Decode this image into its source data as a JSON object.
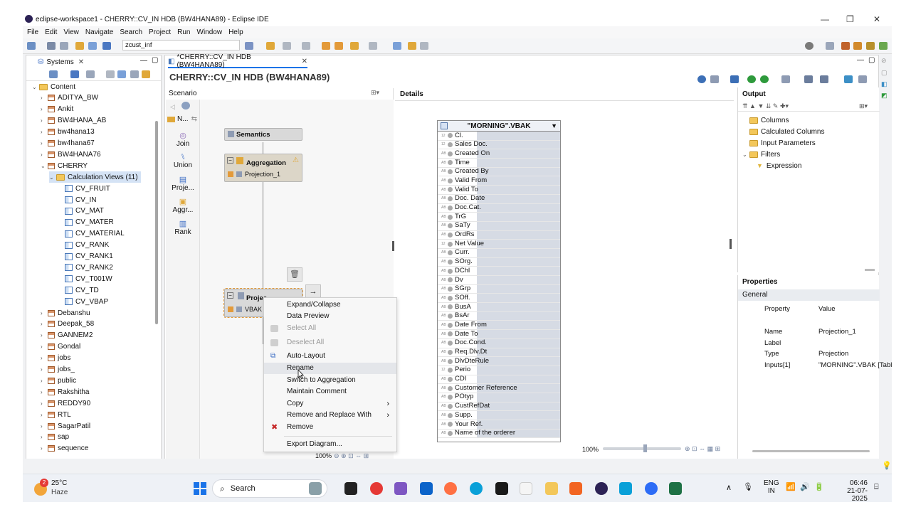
{
  "window": {
    "title": "eclipse-workspace1 - CHERRY::CV_IN HDB (BW4HANA89) - Eclipse IDE",
    "minimize": "—",
    "restore": "❐",
    "close": "✕"
  },
  "menu": [
    "File",
    "Edit",
    "View",
    "Navigate",
    "Search",
    "Project",
    "Run",
    "Window",
    "Help"
  ],
  "toolbar": {
    "search_value": "zcust_inf"
  },
  "systems": {
    "tab_label": "Systems",
    "items": [
      {
        "label": "Content",
        "type": "folder",
        "expanded": true
      },
      {
        "label": "ADITYA_BW",
        "type": "package"
      },
      {
        "label": "Ankit",
        "type": "package"
      },
      {
        "label": "BW4HANA_AB",
        "type": "package"
      },
      {
        "label": "bw4hana13",
        "type": "package"
      },
      {
        "label": "bw4hana67",
        "type": "package"
      },
      {
        "label": "BW4HANA76",
        "type": "package"
      },
      {
        "label": "CHERRY",
        "type": "package",
        "expanded": true
      },
      {
        "label": "Calculation Views (11)",
        "type": "folder",
        "expanded": true,
        "selected": true
      },
      {
        "label": "CV_FRUIT",
        "type": "cv"
      },
      {
        "label": "CV_IN",
        "type": "cv"
      },
      {
        "label": "CV_MAT",
        "type": "cv"
      },
      {
        "label": "CV_MATER",
        "type": "cv"
      },
      {
        "label": "CV_MATERIAL",
        "type": "cv"
      },
      {
        "label": "CV_RANK",
        "type": "cv"
      },
      {
        "label": "CV_RANK1",
        "type": "cv"
      },
      {
        "label": "CV_RANK2",
        "type": "cv"
      },
      {
        "label": "CV_T001W",
        "type": "cv"
      },
      {
        "label": "CV_TD",
        "type": "cv"
      },
      {
        "label": "CV_VBAP",
        "type": "cv"
      },
      {
        "label": "Debanshu",
        "type": "package"
      },
      {
        "label": "Deepak_58",
        "type": "package"
      },
      {
        "label": "GANNEM2",
        "type": "package"
      },
      {
        "label": "Gondal",
        "type": "package"
      },
      {
        "label": "jobs",
        "type": "package"
      },
      {
        "label": "jobs_",
        "type": "package"
      },
      {
        "label": "public",
        "type": "package"
      },
      {
        "label": "Rakshitha",
        "type": "package"
      },
      {
        "label": "REDDY90",
        "type": "package"
      },
      {
        "label": "RTL",
        "type": "package"
      },
      {
        "label": "SagarPatil",
        "type": "package"
      },
      {
        "label": "sap",
        "type": "package"
      },
      {
        "label": "sequence",
        "type": "package"
      }
    ]
  },
  "editor": {
    "tab_label": "*CHERRY::CV_IN HDB (BW4HANA89)",
    "heading": "CHERRY::CV_IN HDB (BW4HANA89)",
    "scenario_label": "Scenario",
    "details_label": "Details",
    "palette_n": "N...",
    "palette": [
      "Join",
      "Union",
      "Proje...",
      "Aggr...",
      "Rank"
    ],
    "nodes": {
      "semantics": "Semantics",
      "aggregation": "Aggregation",
      "aggregation_child": "Projection_1",
      "projection": "Projec",
      "projection_child": "VBAK"
    },
    "zoom_left": "100%",
    "zoom_right": "100%"
  },
  "context_menu": [
    {
      "label": "Expand/Collapse",
      "disabled": false
    },
    {
      "label": "Data Preview",
      "disabled": false
    },
    {
      "label": "Select All",
      "disabled": true
    },
    {
      "label": "Deselect All",
      "disabled": true
    },
    {
      "label": "Auto-Layout",
      "disabled": false
    },
    {
      "label": "Rename",
      "disabled": false
    },
    {
      "label": "Switch to Aggregation",
      "disabled": false
    },
    {
      "label": "Maintain Comment",
      "disabled": false
    },
    {
      "label": "Copy",
      "disabled": false,
      "submenu": true
    },
    {
      "label": "Remove and Replace With",
      "disabled": false,
      "submenu": true
    },
    {
      "label": "Remove",
      "disabled": false
    },
    {
      "label": "Export Diagram...",
      "disabled": false
    }
  ],
  "table": {
    "title": "\"MORNING\".VBAK",
    "columns": [
      {
        "type": "12",
        "name": "Cl."
      },
      {
        "type": "12",
        "name": "Sales Doc."
      },
      {
        "type": "AB",
        "name": "Created On"
      },
      {
        "type": "AB",
        "name": "Time"
      },
      {
        "type": "AB",
        "name": "Created By"
      },
      {
        "type": "AB",
        "name": "Valid From"
      },
      {
        "type": "AB",
        "name": "Valid To"
      },
      {
        "type": "AB",
        "name": "Doc. Date"
      },
      {
        "type": "AB",
        "name": "Doc.Cat."
      },
      {
        "type": "AB",
        "name": "TrG"
      },
      {
        "type": "AB",
        "name": "SaTy"
      },
      {
        "type": "AB",
        "name": "OrdRs"
      },
      {
        "type": "12",
        "name": "Net Value"
      },
      {
        "type": "AB",
        "name": "Curr."
      },
      {
        "type": "AB",
        "name": "SOrg."
      },
      {
        "type": "AB",
        "name": "DChl"
      },
      {
        "type": "AB",
        "name": "Dv"
      },
      {
        "type": "AB",
        "name": "SGrp"
      },
      {
        "type": "AB",
        "name": "SOff."
      },
      {
        "type": "AB",
        "name": "BusA"
      },
      {
        "type": "AB",
        "name": "BsAr"
      },
      {
        "type": "AB",
        "name": "Date From"
      },
      {
        "type": "AB",
        "name": "Date To"
      },
      {
        "type": "AB",
        "name": "Doc.Cond."
      },
      {
        "type": "AB",
        "name": "Req.Dlv.Dt"
      },
      {
        "type": "AB",
        "name": "DlvDteRule"
      },
      {
        "type": "12",
        "name": "Perio"
      },
      {
        "type": "AB",
        "name": "CDI"
      },
      {
        "type": "AB",
        "name": "Customer Reference"
      },
      {
        "type": "AB",
        "name": "POtyp"
      },
      {
        "type": "AB",
        "name": "CustRefDat"
      },
      {
        "type": "AB",
        "name": "Supp."
      },
      {
        "type": "AB",
        "name": "Your Ref."
      },
      {
        "type": "AB",
        "name": "Name of the orderer"
      }
    ]
  },
  "output": {
    "label": "Output",
    "items": [
      {
        "label": "Columns",
        "indent": 1
      },
      {
        "label": "Calculated Columns",
        "indent": 1
      },
      {
        "label": "Input Parameters",
        "indent": 1
      },
      {
        "label": "Filters",
        "indent": 0
      },
      {
        "label": "Expression",
        "indent": 2
      }
    ]
  },
  "properties": {
    "label": "Properties",
    "section": "General",
    "header": {
      "k": "Property",
      "v": "Value"
    },
    "rows": [
      {
        "k": "Name",
        "v": "Projection_1"
      },
      {
        "k": "Label",
        "v": ""
      },
      {
        "k": "Type",
        "v": "Projection"
      },
      {
        "k": "Inputs[1]",
        "v": "\"MORNING\".VBAK [Table]"
      }
    ]
  },
  "taskbar": {
    "weather_temp": "25°C",
    "weather_desc": "Haze",
    "weather_badge": "2",
    "search_label": "Search",
    "lang_top": "ENG",
    "lang_bottom": "IN",
    "time": "06:46",
    "date": "21-07-2025"
  },
  "colors": {
    "accent": "#1a73e8",
    "selection": "#d5e3f5",
    "table_header": "#eef1f6",
    "error": "#c62828"
  }
}
